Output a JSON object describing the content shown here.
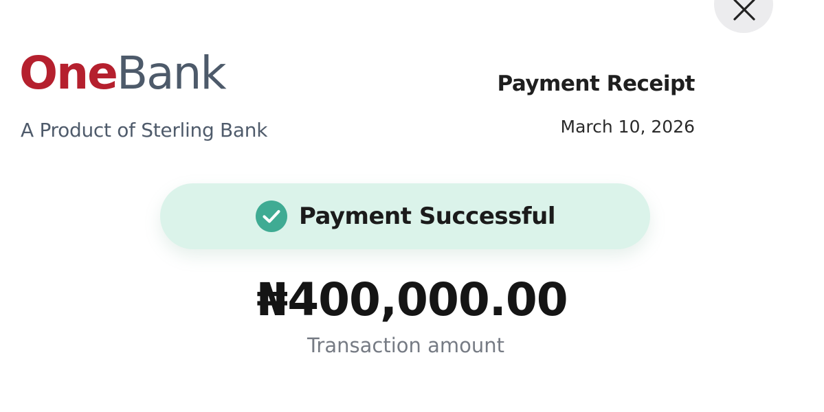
{
  "close": {
    "icon": "close-icon",
    "background": "#ececee"
  },
  "brand": {
    "logo_part1": "One",
    "logo_part2": "Bank",
    "logo_colors": {
      "part1": "#b5202e",
      "part2": "#4d5a6a"
    },
    "tagline": "A Product of Sterling Bank"
  },
  "receipt": {
    "title": "Payment Receipt",
    "date": "March 10, 2026"
  },
  "status": {
    "icon": "check-circle-icon",
    "text": "Payment Successful",
    "background": "#dbf3ea",
    "icon_color": "#3fab93"
  },
  "transaction": {
    "amount": "₦400,000.00",
    "label": "Transaction amount"
  }
}
